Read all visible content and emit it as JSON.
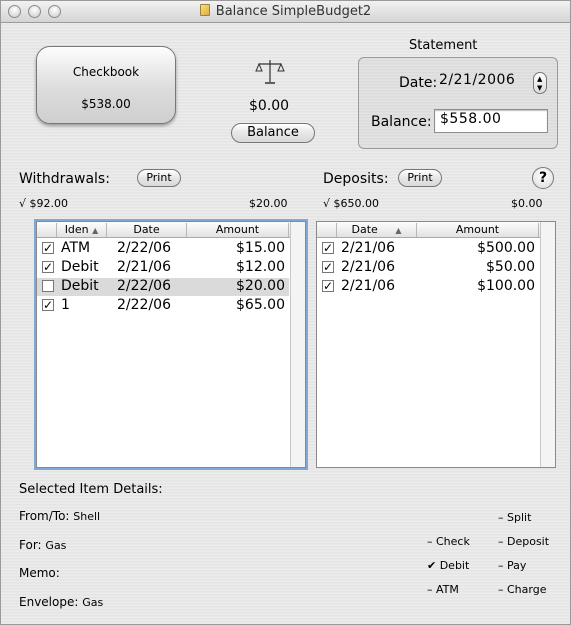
{
  "window": {
    "title": "Balance SimpleBudget2"
  },
  "checkbook": {
    "label": "Checkbook",
    "amount": "$538.00"
  },
  "balance": {
    "amount": "$0.00",
    "button_label": "Balance"
  },
  "statement": {
    "title": "Statement",
    "date_label": "Date:",
    "date_value": "2/21/2006",
    "balance_label": "Balance:",
    "balance_value": "$558.00"
  },
  "withdrawals": {
    "label": "Withdrawals:",
    "print_label": "Print",
    "checked_total": "√ $92.00",
    "unchecked_total": "$20.00",
    "columns": [
      "Iden",
      "Date",
      "Amount"
    ],
    "rows": [
      {
        "checked": true,
        "iden": "ATM",
        "date": "2/22/06",
        "amount": "$15.00"
      },
      {
        "checked": true,
        "iden": "Debit",
        "date": "2/21/06",
        "amount": "$12.00"
      },
      {
        "checked": false,
        "iden": "Debit",
        "date": "2/22/06",
        "amount": "$20.00"
      },
      {
        "checked": true,
        "iden": "1",
        "date": "2/22/06",
        "amount": "$65.00"
      }
    ]
  },
  "deposits": {
    "label": "Deposits:",
    "print_label": "Print",
    "checked_total": "√ $650.00",
    "unchecked_total": "$0.00",
    "columns": [
      "Date",
      "Amount"
    ],
    "rows": [
      {
        "checked": true,
        "date": "2/21/06",
        "amount": "$500.00"
      },
      {
        "checked": true,
        "date": "2/21/06",
        "amount": "$50.00"
      },
      {
        "checked": true,
        "date": "2/21/06",
        "amount": "$100.00"
      }
    ]
  },
  "help": {
    "label": "?"
  },
  "details": {
    "heading": "Selected Item Details:",
    "from_to_label": "From/To:",
    "from_to_value": "Shell",
    "for_label": "For:",
    "for_value": "Gas",
    "memo_label": "Memo:",
    "memo_value": "",
    "envelope_label": "Envelope:",
    "envelope_value": "Gas"
  },
  "types": {
    "split": "– Split",
    "check": "– Check",
    "deposit": "– Deposit",
    "debit": "✔ Debit",
    "pay": "– Pay",
    "atm": "– ATM",
    "charge": "– Charge"
  },
  "colors": {
    "focus_ring": "#7fa8d8",
    "selected_row": "#dadada"
  }
}
